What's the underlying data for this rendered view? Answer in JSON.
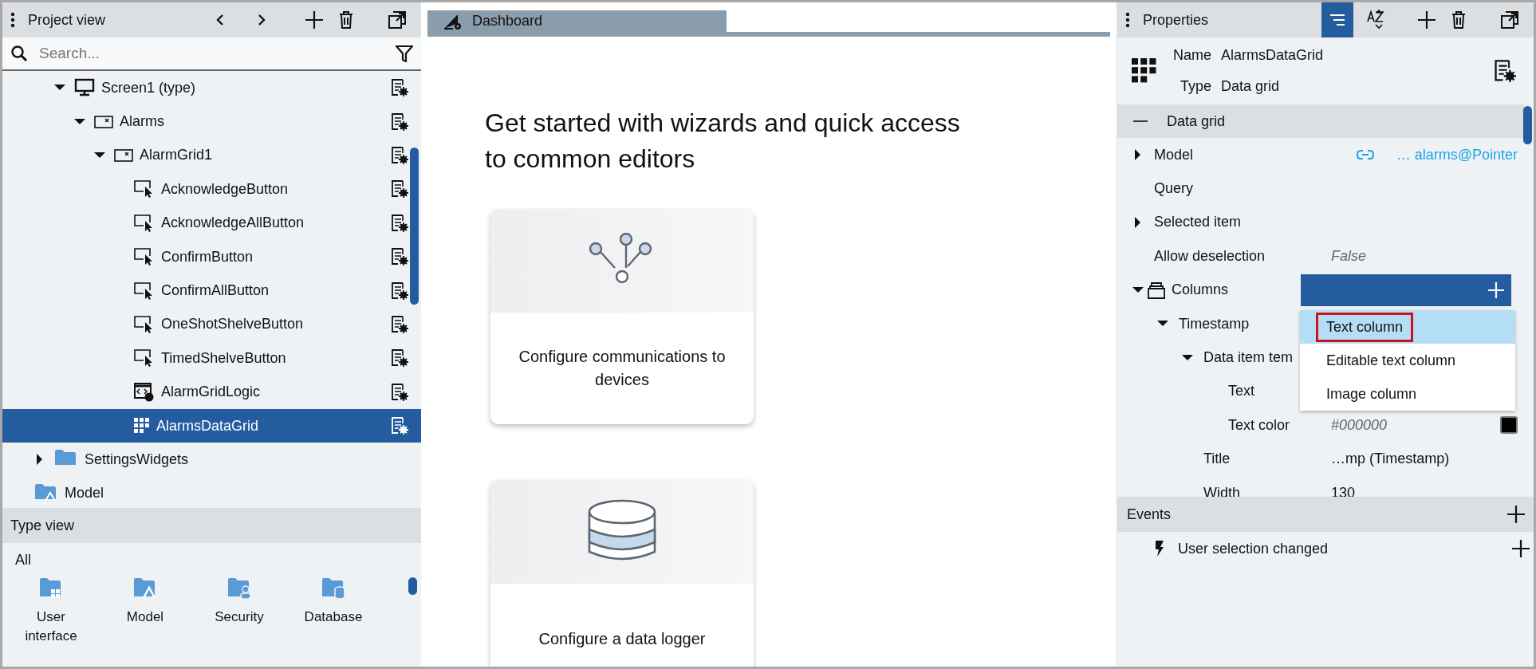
{
  "project_view": {
    "title": "Project view",
    "search": {
      "placeholder": "Search..."
    },
    "tree": [
      {
        "children": [
          {
            "children": [
              {
                "label": "Screen1 (type)",
                "kind": "screen",
                "expanded": true,
                "selected": false,
                "children": [
                  {
                    "label": "Alarms",
                    "kind": "panel",
                    "expanded": true,
                    "selected": false,
                    "children": [
                      {
                        "label": "AlarmGrid1",
                        "kind": "panel",
                        "expanded": true,
                        "selected": false,
                        "children": [
                          {
                            "label": "AcknowledgeButton",
                            "kind": "button",
                            "selected": false
                          },
                          {
                            "label": "AcknowledgeAllButton",
                            "kind": "button",
                            "selected": false
                          },
                          {
                            "label": "ConfirmButton",
                            "kind": "button",
                            "selected": false
                          },
                          {
                            "label": "ConfirmAllButton",
                            "kind": "button",
                            "selected": false
                          },
                          {
                            "label": "OneShotShelveButton",
                            "kind": "button",
                            "selected": false
                          },
                          {
                            "label": "TimedShelveButton",
                            "kind": "button",
                            "selected": false
                          },
                          {
                            "label": "AlarmGridLogic",
                            "kind": "logic",
                            "selected": false
                          },
                          {
                            "label": "AlarmsDataGrid",
                            "kind": "grid",
                            "selected": true
                          }
                        ]
                      }
                    ]
                  }
                ]
              }
            ]
          },
          {
            "label": "SettingsWidgets",
            "kind": "folder",
            "expanded": false,
            "selected": false
          }
        ]
      },
      {
        "label": "Model",
        "kind": "model-folder",
        "selected": false
      }
    ]
  },
  "type_view": {
    "title": "Type view",
    "filter": "All",
    "items": [
      {
        "label": "User interface",
        "kind": "ui"
      },
      {
        "label": "Model",
        "kind": "model"
      },
      {
        "label": "Security",
        "kind": "security"
      },
      {
        "label": "Database",
        "kind": "database"
      }
    ]
  },
  "editor": {
    "tabs": [
      {
        "label": "Dashboard",
        "selected": true
      }
    ],
    "heading": "Get started with wizards and quick access to common editors",
    "cards": [
      {
        "label": "Configure communications to devices",
        "kind": "network"
      },
      {
        "label": "Configure a data logger",
        "kind": "database"
      }
    ]
  },
  "properties": {
    "title": "Properties",
    "toolbar": [
      {
        "kind": "categorized",
        "selected": true
      },
      {
        "kind": "sort",
        "selected": false
      }
    ],
    "name_label": "Name",
    "name": "AlarmsDataGrid",
    "type_label": "Type",
    "type": "Data grid",
    "section": "Data grid",
    "rows": [
      {
        "label": "Model",
        "kind": "link",
        "expanded": false,
        "value": "… alarms@Pointer"
      },
      {
        "label": "Query"
      },
      {
        "label": "Selected item",
        "expanded": false
      },
      {
        "label": "Allow deselection",
        "kind": "default",
        "value": "False"
      },
      {
        "label": "Columns",
        "kind": "collection",
        "expanded": true,
        "children": [
          {
            "label": "Timestamp",
            "expanded": true,
            "children": [
              {
                "label": "Data item tem",
                "expanded": true,
                "children": [
                  {
                    "label": "Text"
                  },
                  {
                    "label": "Text color",
                    "kind": "default",
                    "value": "#000000",
                    "color": "#000000"
                  }
                ]
              },
              {
                "label": "Title",
                "kind": "plain",
                "value": "…mp (Timestamp)"
              },
              {
                "label": "Width",
                "kind": "plain",
                "value": "130"
              }
            ]
          }
        ]
      }
    ],
    "menu": [
      {
        "label": "Text column",
        "selected": true,
        "marked": true
      },
      {
        "label": "Editable text column",
        "selected": false,
        "marked": false
      },
      {
        "label": "Image column",
        "selected": false,
        "marked": false
      }
    ],
    "events_title": "Events",
    "events": [
      {
        "label": "User selection changed"
      }
    ]
  }
}
